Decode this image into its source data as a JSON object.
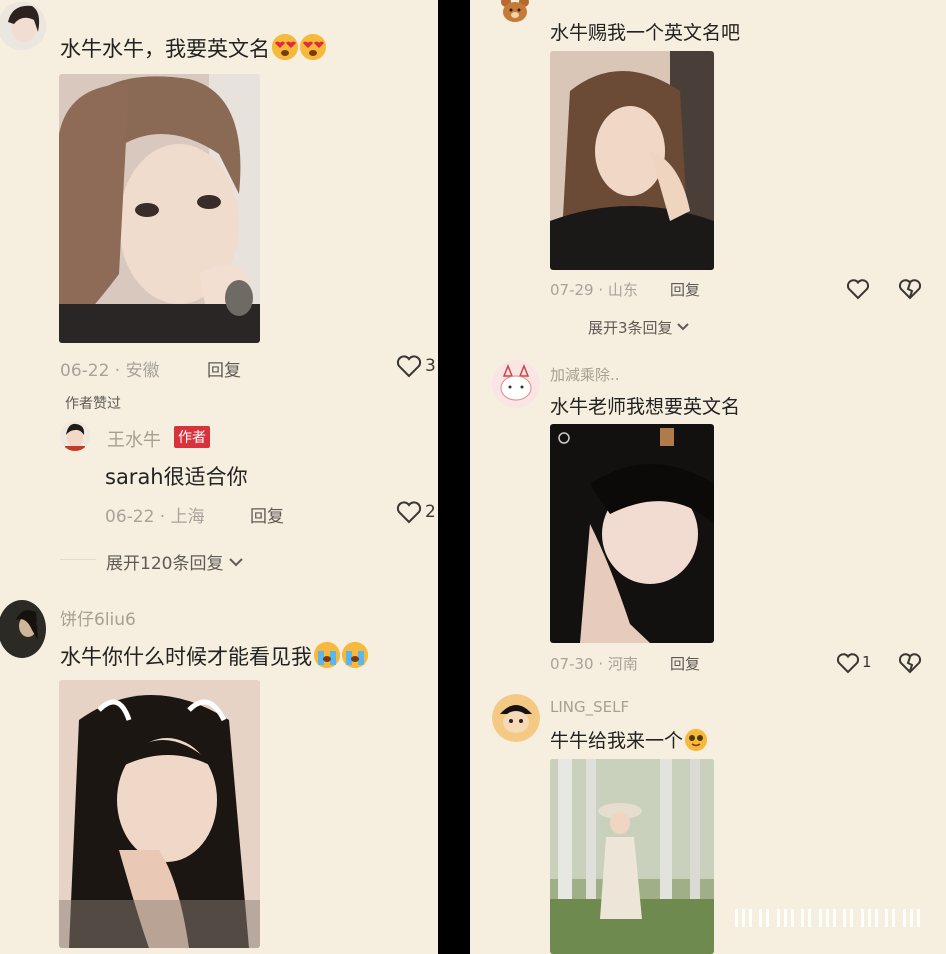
{
  "left": {
    "comment1": {
      "text": "水牛水牛，我要英文名",
      "date": "06-22",
      "location": "安徽",
      "reply_label": "回复",
      "like_count": "3",
      "author_liked": "作者赞过"
    },
    "author_reply": {
      "name": "王水牛",
      "badge": "作者",
      "text": "sarah很适合你",
      "date": "06-22",
      "location": "上海",
      "reply_label": "回复",
      "like_count": "2"
    },
    "expand_label": "展开120条回复",
    "comment2": {
      "name": "饼仔6liu6",
      "text": "水牛你什么时候才能看见我"
    }
  },
  "right": {
    "comment1": {
      "text": "水牛赐我一个英文名吧",
      "date": "07-29",
      "location": "山东",
      "reply_label": "回复"
    },
    "expand_label": "展开3条回复",
    "comment2": {
      "name": "加減乘除..",
      "text": "水牛老师我想要英文名",
      "date": "07-30",
      "location": "河南",
      "reply_label": "回复",
      "like_count": "1"
    },
    "comment3": {
      "name": "LING_SELF",
      "text": "牛牛给我来一个"
    }
  },
  "colors": {
    "background": "#f6efdf",
    "divider": "#000000",
    "author_badge": "#d8323d"
  }
}
